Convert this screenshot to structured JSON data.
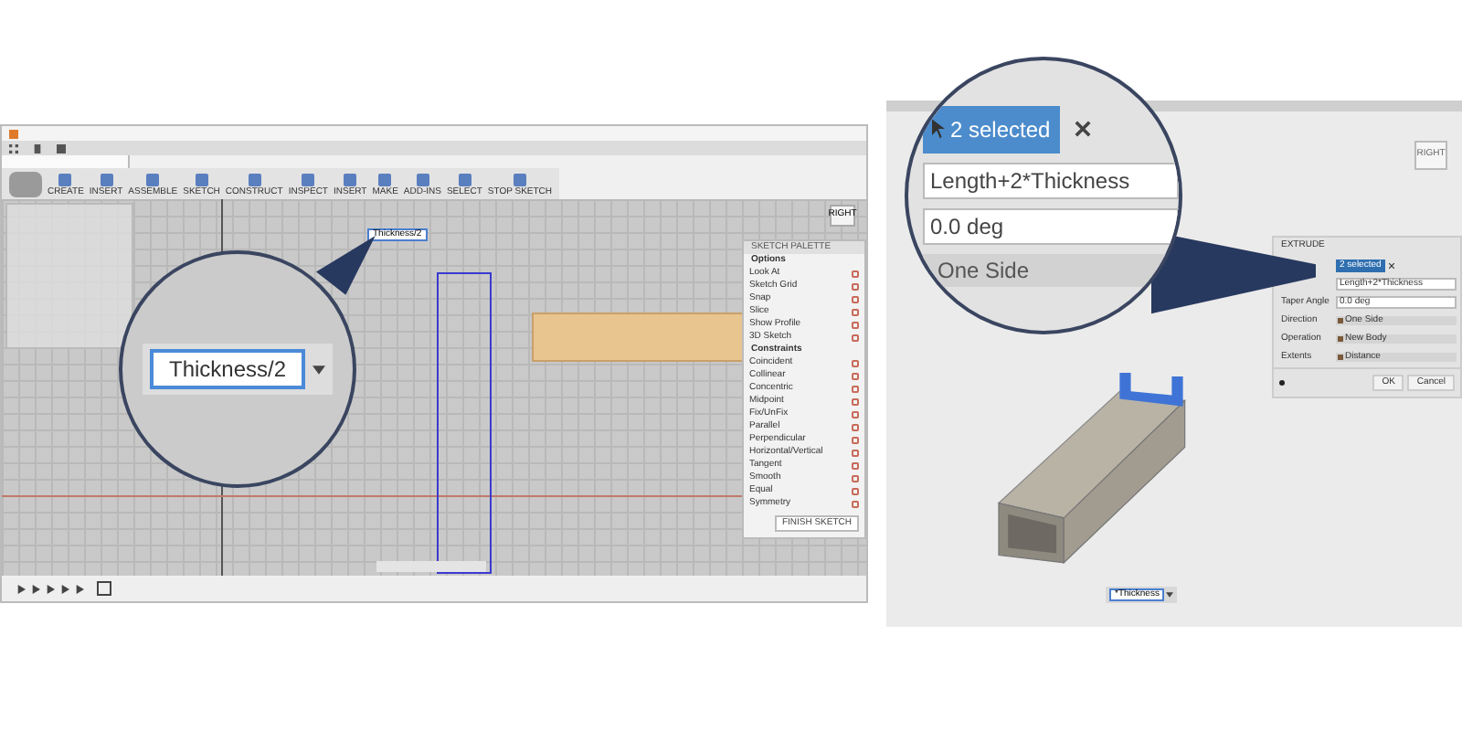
{
  "left_screen": {
    "toolbar": [
      {
        "label": "CREATE"
      },
      {
        "label": "INSERT"
      },
      {
        "label": "ASSEMBLE"
      },
      {
        "label": "SKETCH"
      },
      {
        "label": "CONSTRUCT"
      },
      {
        "label": "INSPECT"
      },
      {
        "label": "INSERT"
      },
      {
        "label": "MAKE"
      },
      {
        "label": "ADD-INS"
      },
      {
        "label": "SELECT"
      },
      {
        "label": "STOP SKETCH"
      }
    ],
    "view_cube": "RIGHT",
    "dimension_field": "Thickness/2",
    "magnifier": {
      "value": "Thickness/2"
    },
    "palette": {
      "title": "SKETCH PALETTE",
      "sections": [
        {
          "title": "Options",
          "items": [
            "Look At",
            "Sketch Grid",
            "Snap",
            "Slice",
            "Show Profile",
            "3D Sketch"
          ]
        },
        {
          "title": "Constraints",
          "items": [
            "Coincident",
            "Collinear",
            "Concentric",
            "Midpoint",
            "Fix/UnFix",
            "Parallel",
            "Perpendicular",
            "Horizontal/Vertical",
            "Tangent",
            "Smooth",
            "Equal",
            "Symmetry"
          ]
        }
      ],
      "button": "FINISH SKETCH"
    }
  },
  "right_screen": {
    "view_cube": "RIGHT",
    "magnifier": {
      "selection": "2 selected",
      "distance": "Length+2*Thickness",
      "taper": "0.0 deg",
      "direction": "One Side"
    },
    "dialog": {
      "title": "EXTRUDE",
      "rows": [
        {
          "kind": "selection",
          "value": "2 selected"
        },
        {
          "kind": "field",
          "value": "Length+2*Thickness"
        },
        {
          "kind": "field",
          "label": "Taper Angle",
          "value": "0.0 deg"
        },
        {
          "kind": "dropdown",
          "label": "Direction",
          "value": "One Side"
        },
        {
          "kind": "dropdown",
          "label": "Operation",
          "value": "New Body"
        },
        {
          "kind": "dropdown",
          "label": "Extents",
          "value": "Distance"
        }
      ],
      "buttons": [
        "OK",
        "Cancel"
      ]
    },
    "canvas_field": "*Thickness"
  }
}
